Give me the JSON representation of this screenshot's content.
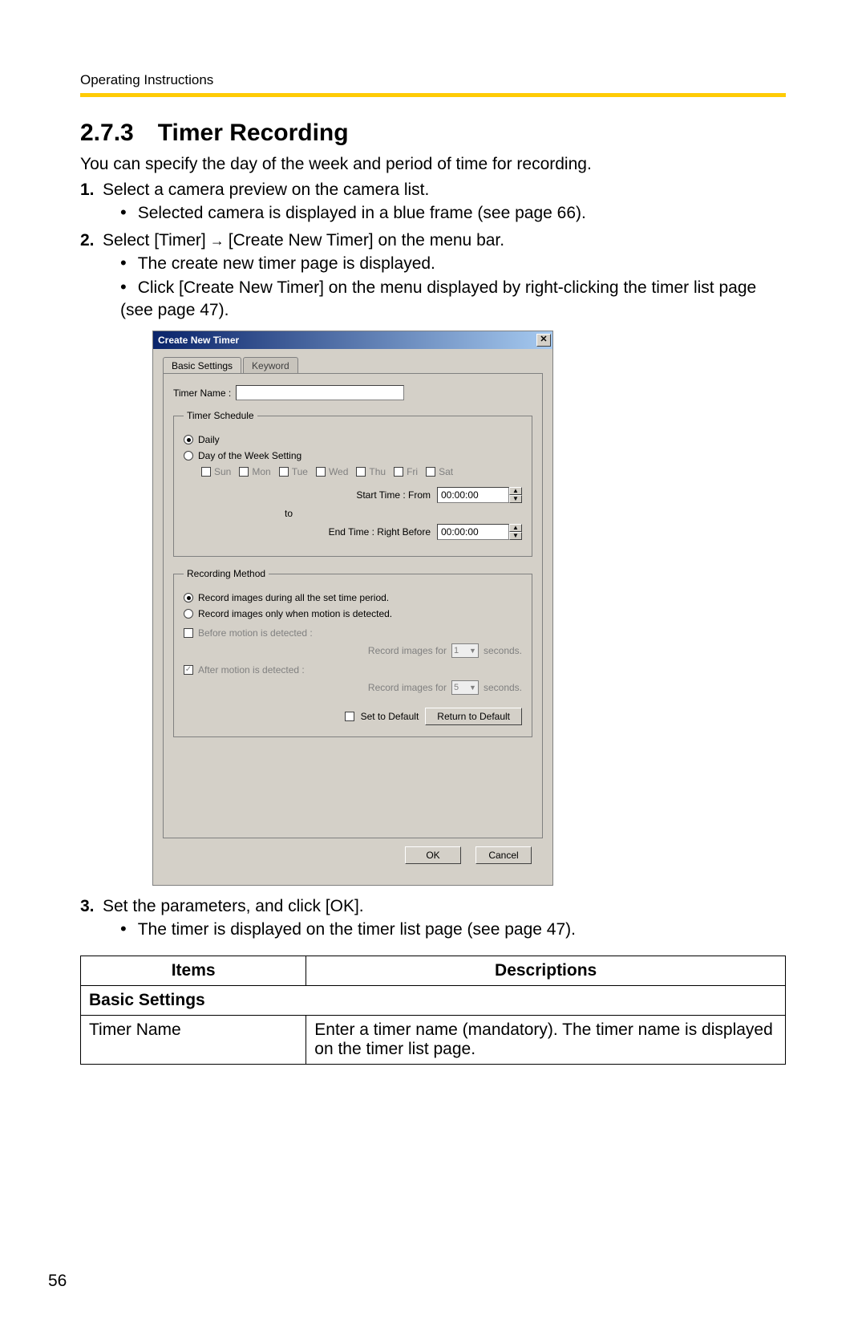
{
  "header": "Operating Instructions",
  "section_number": "2.7.3",
  "section_title": "Timer Recording",
  "intro": "You can specify the day of the week and period of time for recording.",
  "steps": [
    {
      "num": "1.",
      "text": "Select a camera preview on the camera list.",
      "subs": [
        "Selected camera is displayed in a blue frame (see page 66)."
      ]
    },
    {
      "num": "2.",
      "text_pre": "Select [Timer]",
      "text_post": "[Create New Timer] on the menu bar.",
      "subs": [
        "The create new timer page is displayed.",
        "Click [Create New Timer] on the menu displayed by right-clicking the timer list page (see page 47)."
      ]
    },
    {
      "num": "3.",
      "text": "Set the parameters, and click [OK].",
      "subs": [
        "The timer is displayed on the timer list page (see page 47)."
      ]
    }
  ],
  "dialog": {
    "title": "Create New Timer",
    "tabs": {
      "basic": "Basic Settings",
      "keyword": "Keyword"
    },
    "timer_name_label": "Timer Name :",
    "timer_name_value": "",
    "schedule": {
      "legend": "Timer Schedule",
      "daily": "Daily",
      "dow": "Day of the Week Setting",
      "days": [
        "Sun",
        "Mon",
        "Tue",
        "Wed",
        "Thu",
        "Fri",
        "Sat"
      ],
      "start_label": "Start Time :   From",
      "start_value": "00:00:00",
      "to": "to",
      "end_label": "End Time :   Right Before",
      "end_value": "00:00:00"
    },
    "method": {
      "legend": "Recording Method",
      "opt1": "Record images during all the set time period.",
      "opt2": "Record images only when motion is detected.",
      "before": "Before motion is detected :",
      "after": "After motion is detected :",
      "record_for": "Record images for",
      "seconds": "seconds.",
      "val_before": "1",
      "val_after": "5",
      "set_default": "Set to Default",
      "return_default": "Return to Default"
    },
    "ok": "OK",
    "cancel": "Cancel"
  },
  "table": {
    "h1": "Items",
    "h2": "Descriptions",
    "subhead": "Basic Settings",
    "r1_item": "Timer Name",
    "r1_desc": "Enter a timer name (mandatory). The timer name is displayed on the timer list page."
  },
  "page_number": "56"
}
